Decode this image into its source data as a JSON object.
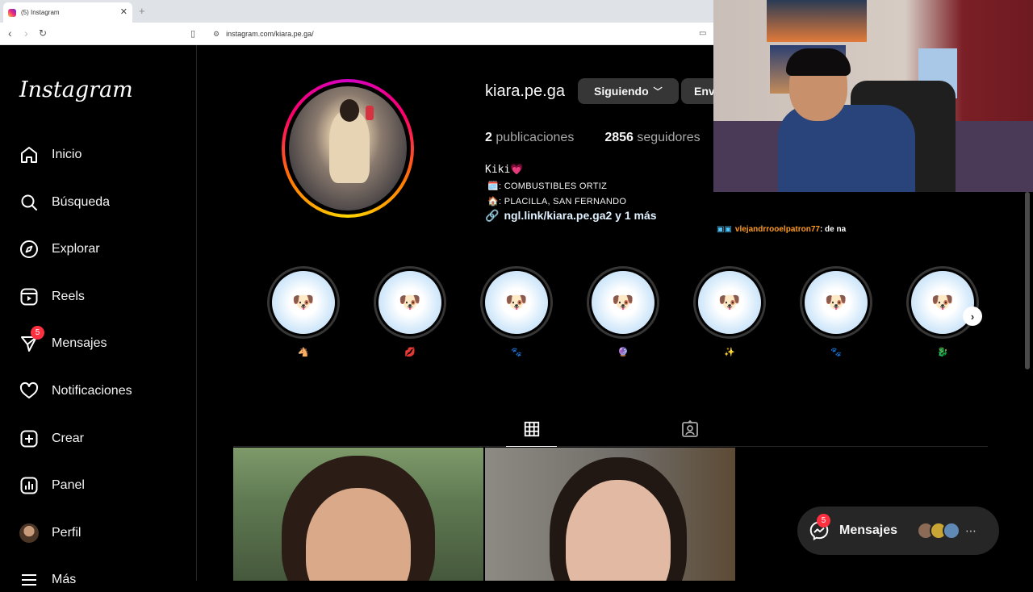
{
  "browser": {
    "tab_title": "(5) Instagram",
    "url": "instagram.com/kiara.pe.ga/"
  },
  "sidebar": {
    "logo": "Instagram",
    "items": [
      {
        "label": "Inicio",
        "icon": "home-icon"
      },
      {
        "label": "Búsqueda",
        "icon": "search-icon"
      },
      {
        "label": "Explorar",
        "icon": "compass-icon"
      },
      {
        "label": "Reels",
        "icon": "reels-icon"
      },
      {
        "label": "Mensajes",
        "icon": "messenger-icon",
        "badge": "5"
      },
      {
        "label": "Notificaciones",
        "icon": "heart-icon"
      },
      {
        "label": "Crear",
        "icon": "plus-square-icon"
      },
      {
        "label": "Panel",
        "icon": "chart-icon"
      },
      {
        "label": "Perfil",
        "icon": "avatar-icon"
      },
      {
        "label": "Más",
        "icon": "menu-icon"
      }
    ]
  },
  "profile": {
    "username": "kiara.pe.ga",
    "following_label": "Siguiendo",
    "message_label": "Envi",
    "posts_count": "2",
    "posts_label": "publicaciones",
    "followers_count": "2856",
    "followers_label": "seguidores",
    "bio_name": "Kiki💗",
    "bio_line1": "🗓️: COMBUSTIBLES ORTIZ",
    "bio_line2": "🏠: PLACILLA, SAN FERNANDO",
    "bio_link": "ngl.link/kiara.pe.ga2 y 1 más"
  },
  "highlights": [
    {
      "label": "🐴"
    },
    {
      "label": "💋"
    },
    {
      "label": "🐾"
    },
    {
      "label": "🔮"
    },
    {
      "label": "✨"
    },
    {
      "label": "🐾"
    },
    {
      "label": "🐉"
    }
  ],
  "chat": {
    "user": "vlejandrrooelpatron77",
    "message": ": de na"
  },
  "messages_pill": {
    "label": "Mensajes",
    "badge": "5"
  },
  "colors": {
    "accent_badge": "#ff3040",
    "background": "#000000",
    "button_bg": "#363636"
  }
}
